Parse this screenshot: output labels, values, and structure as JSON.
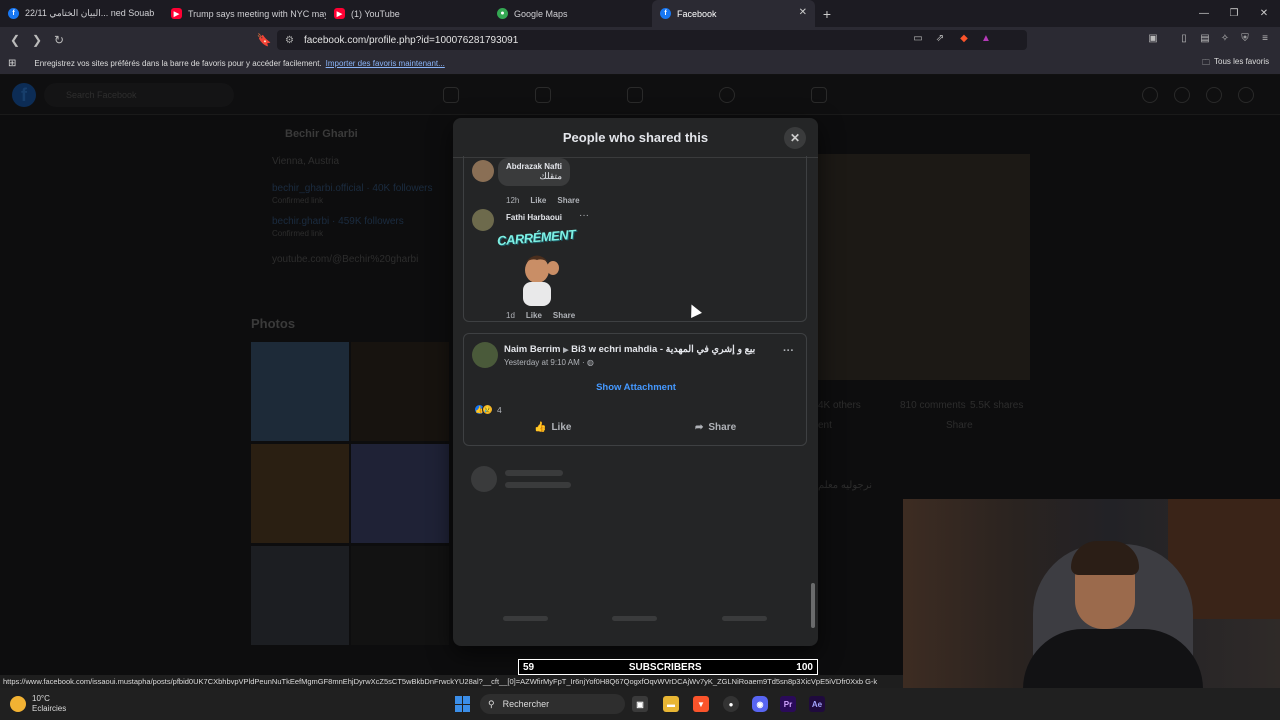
{
  "browser": {
    "tabs": [
      {
        "label": "البيان الختامي 22/11... ned Souab",
        "icon": "facebook-icon",
        "color": "#1877f2"
      },
      {
        "label": "Trump says meeting with NYC mayor",
        "icon": "youtube-icon",
        "color": "#ff0033"
      },
      {
        "label": "(1) YouTube",
        "icon": "youtube-icon",
        "color": "#ff0033"
      },
      {
        "label": "Google Maps",
        "icon": "maps-pin-icon",
        "color": "#34a853"
      },
      {
        "label": "Facebook",
        "icon": "facebook-icon",
        "color": "#1877f2",
        "active": true
      }
    ],
    "url": "facebook.com/profile.php?id=100076281793091",
    "bookmarks_text": "Enregistrez vos sites préférés dans la barre de favoris pour y accéder facilement.",
    "bookmarks_link": "Importer des favoris maintenant...",
    "all_bookmarks": "Tous les favoris",
    "status_url": "https://www.facebook.com/issaoui.mustapha/posts/pfbid0UK7CXbhbvpVPldPeunNuTkEefMgmGF8mnEhjDyrwXcZ5sCT5wBkbDnFrwckYU28al?__cft__[0]=AZWfirMyFpT_Ir6njYof0H8Q67QogxfOqvWVrDCAjWv7yK_ZGLNiRoaem9Td5sn8p3XicVpE5iVDfr0Xxb G-k"
  },
  "background_page": {
    "search_placeholder": "Search Facebook",
    "profile_name": "Bechir Gharbi",
    "location": "Vienna, Austria",
    "instagram": "bechir_gharbi.official · 40K followers",
    "instagram_sub": "Confirmed link",
    "tiktok": "bechir.gharbi · 459K followers",
    "tiktok_sub": "Confirmed link",
    "youtube": "youtube.com/@Bechir%20gharbi",
    "photos_heading": "Photos",
    "post_stats": "4K others",
    "comments": "810 comments",
    "shares": "5.5K shares",
    "comment_label": "ent",
    "share_label": "Share",
    "arabic_snippet": "نرجوليه معلم"
  },
  "modal": {
    "title": "People who shared this",
    "comments": [
      {
        "name": "Abdrazak Nafti",
        "text": "متقلك",
        "time": "12h",
        "like": "Like",
        "share": "Share"
      },
      {
        "name": "Fathi Harbaoui",
        "sticker_text": "CARRÉMENT",
        "time": "1d",
        "like": "Like",
        "share": "Share"
      }
    ],
    "post": {
      "author": "Naim Berrim",
      "group": "Bi3 w echri mahdia - بيع و إشري في المهدية",
      "time": "Yesterday at 9:10 AM",
      "show_attachment": "Show Attachment",
      "reaction_count": "4",
      "like": "Like",
      "share": "Share"
    }
  },
  "overlay": {
    "subs_current": "59",
    "subs_label": "SUBSCRIBERS",
    "subs_goal": "100"
  },
  "taskbar": {
    "temperature": "10°C",
    "weather": "Eclaircies",
    "search": "Rechercher"
  }
}
